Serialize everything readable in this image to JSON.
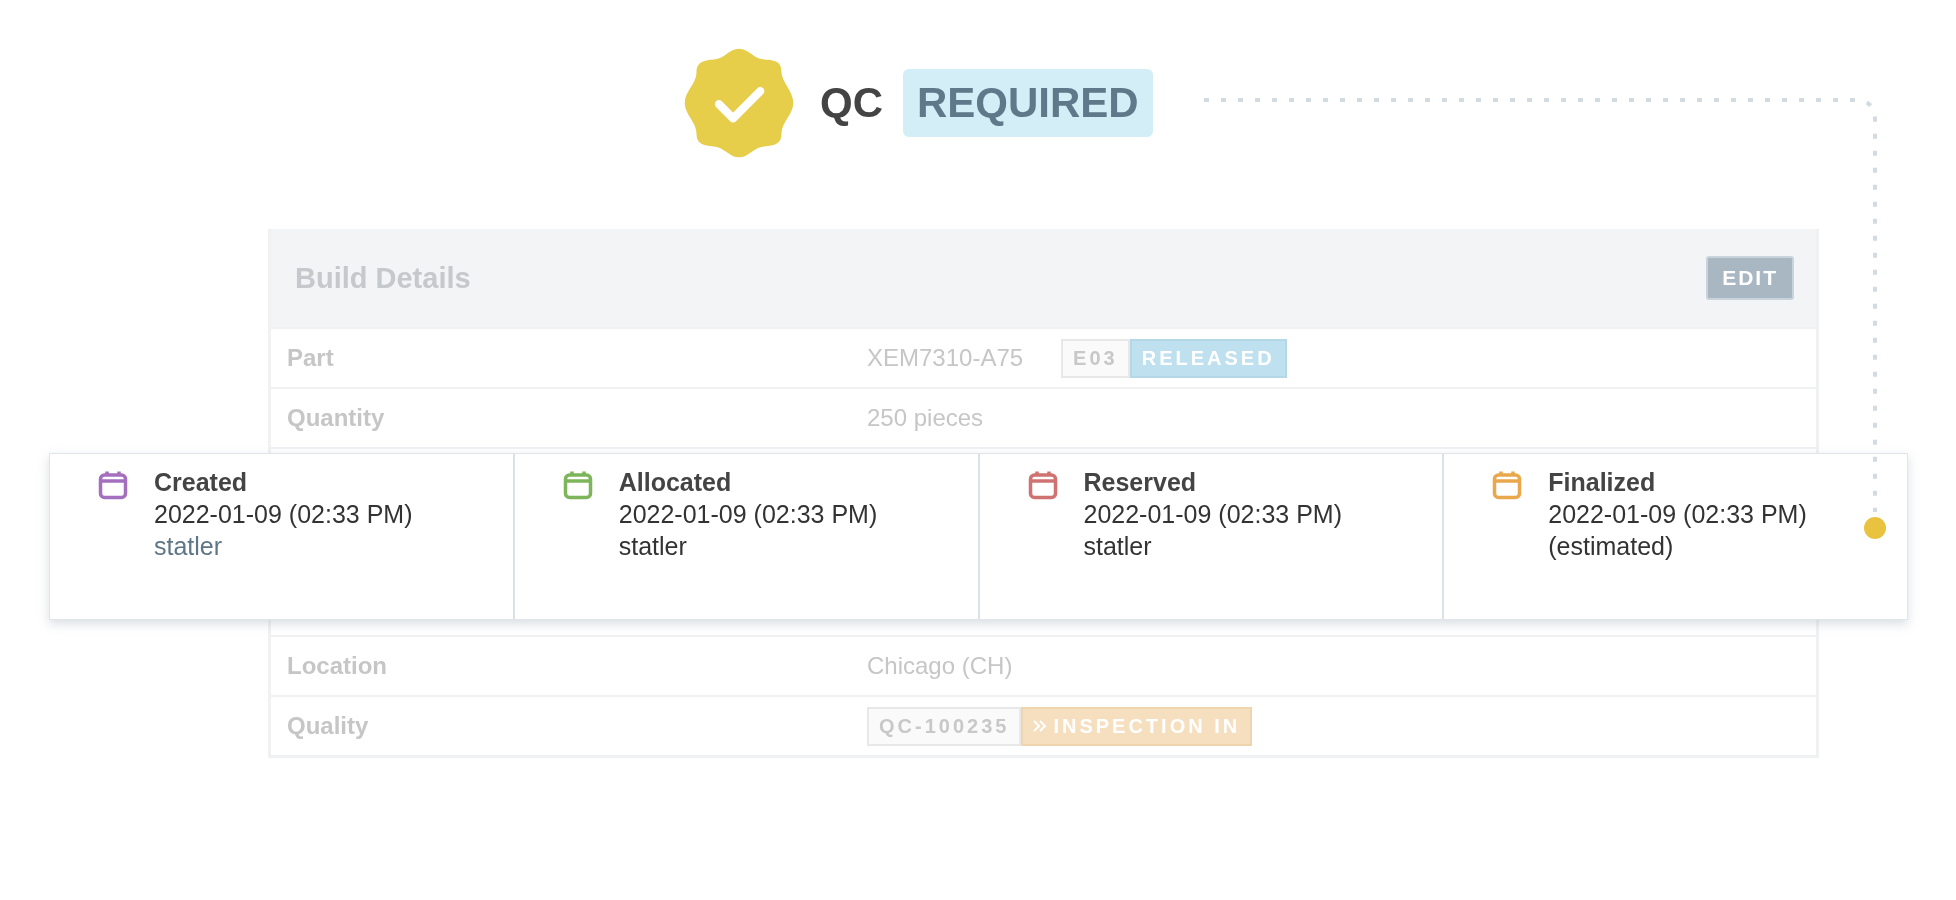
{
  "status": {
    "label": "QC",
    "badge": "REQUIRED"
  },
  "card": {
    "title": "Build Details",
    "edit_button": "EDIT",
    "top_rows": [
      {
        "label": "Part",
        "value": "XEM7310-A75",
        "tags": [
          {
            "text": "E03",
            "kind": "outline"
          },
          {
            "text": "RELEASED",
            "kind": "info"
          }
        ]
      },
      {
        "label": "Quantity",
        "value": "250 pieces",
        "tags": []
      }
    ],
    "bottom_rows": [
      {
        "label": "Location",
        "value": "Chicago (CH)",
        "tags": []
      },
      {
        "label": "Quality",
        "tags": [
          {
            "text": "QC-100235",
            "kind": "outline"
          },
          {
            "text": "INSPECTION IN",
            "kind": "warning"
          }
        ]
      }
    ]
  },
  "timeline": [
    {
      "title": "Created",
      "date": "2022-01-09 (02:33 PM)",
      "detail": "statler",
      "kind": "link",
      "color": "#a56fc0"
    },
    {
      "title": "Allocated",
      "date": "2022-01-09 (02:33 PM)",
      "detail": "statler",
      "kind": "text",
      "color": "#7db55a"
    },
    {
      "title": "Reserved",
      "date": "2022-01-09 (02:33 PM)",
      "detail": "statler",
      "kind": "text",
      "color": "#d07272"
    },
    {
      "title": "Finalized",
      "date": "2022-01-09 (02:33 PM)",
      "detail": "(estimated)",
      "kind": "text",
      "color": "#e9a84b"
    }
  ]
}
